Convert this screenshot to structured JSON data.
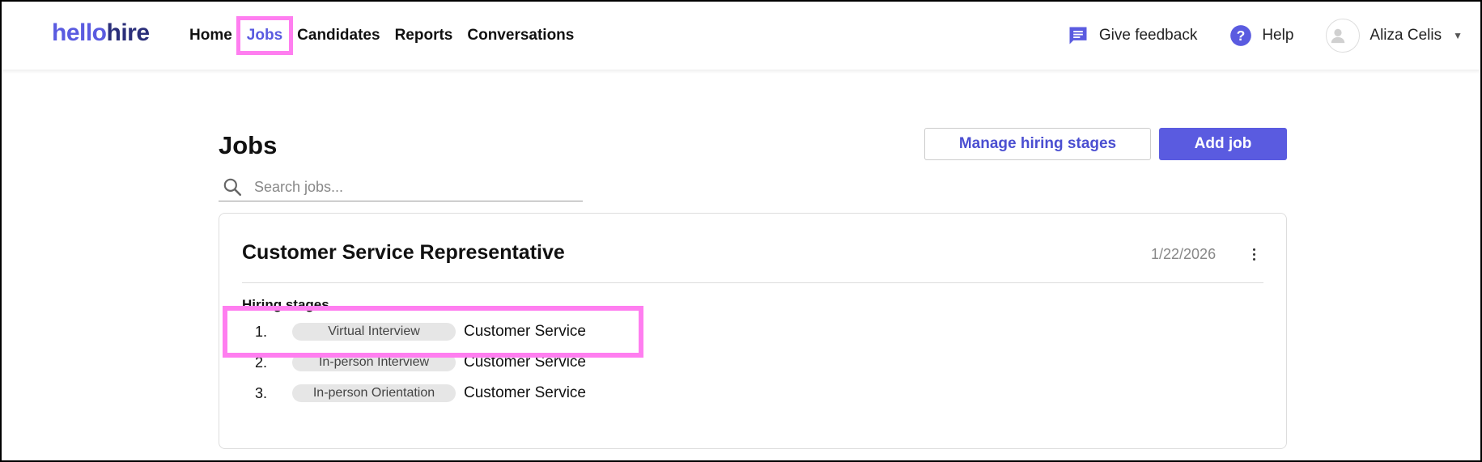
{
  "logo": {
    "hello": "hello",
    "hire": "hire"
  },
  "nav": {
    "home": "Home",
    "jobs": "Jobs",
    "candidates": "Candidates",
    "reports": "Reports",
    "conversations": "Conversations"
  },
  "right_nav": {
    "feedback": "Give feedback",
    "help": "Help",
    "user_name": "Aliza Celis"
  },
  "page": {
    "title": "Jobs",
    "manage_button": "Manage hiring stages",
    "add_button": "Add job",
    "search_placeholder": "Search jobs..."
  },
  "job": {
    "title": "Customer Service Representative",
    "date": "1/22/2026",
    "stages_label": "Hiring stages",
    "stages": [
      {
        "num": "1.",
        "name": "Virtual Interview",
        "dept": "Customer Service"
      },
      {
        "num": "2.",
        "name": "In-person Interview",
        "dept": "Customer Service"
      },
      {
        "num": "3.",
        "name": "In-person Orientation",
        "dept": "Customer Service"
      }
    ]
  },
  "colors": {
    "accent": "#5a5be0",
    "highlight": "#ff7ef0",
    "logo_dark": "#2b2f7a"
  },
  "icons": {
    "feedback": "chat-bubble-icon",
    "help": "question-circle-icon",
    "search": "search-icon",
    "avatar": "user-icon",
    "menu": "kebab-icon"
  }
}
